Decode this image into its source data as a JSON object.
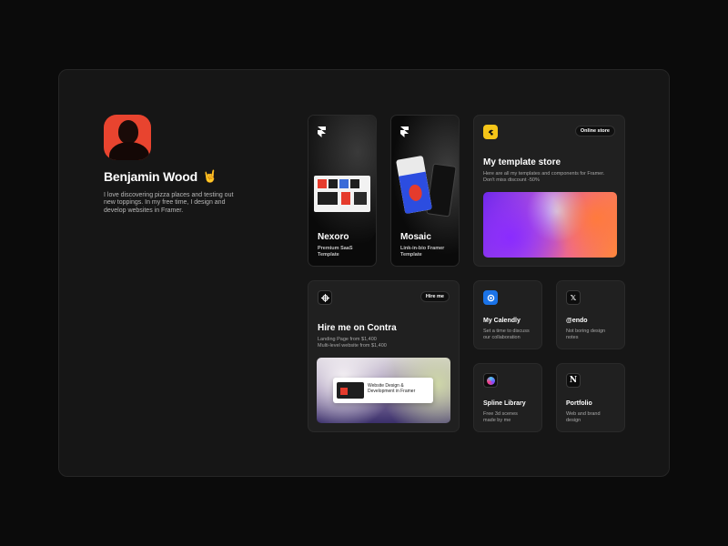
{
  "profile": {
    "name": "Benjamin Wood",
    "emoji": "🤘",
    "bio": "I love discovering pizza places and testing out new toppings. In my free time, I design and develop websites in Framer."
  },
  "cards": {
    "nexoro": {
      "title": "Nexoro",
      "subtitle_line1": "Premium SaaS",
      "subtitle_line2": "Template",
      "icon": "framer-icon"
    },
    "mosaic": {
      "title": "Mosaic",
      "subtitle_line1": "Link-in-bio Framer",
      "subtitle_line2": "Template",
      "icon": "framer-icon"
    },
    "store": {
      "title": "My template store",
      "badge": "Online store",
      "desc_line1": "Here are all my templates and components for Framer.",
      "desc_line2": "Don't miss discount -50%",
      "icon": "lemon-squeezy-icon",
      "icon_color": "#f5c518"
    },
    "contra": {
      "title": "Hire me on Contra",
      "badge": "Hire me",
      "line1": "Landing Page from $1,400",
      "line2": "Multi-level website from $1,400",
      "preview_text": "Website Design & Development in Framer",
      "icon": "contra-icon"
    },
    "calendly": {
      "title": "My Calendly",
      "desc_line1": "Set a time to discuss",
      "desc_line2": "our collaboration",
      "icon": "calendly-icon",
      "icon_color": "#1a73e8"
    },
    "x": {
      "title": "@endo",
      "desc_line1": "Not boring design",
      "desc_line2": "notes",
      "icon": "x-icon"
    },
    "spline": {
      "title": "Spline Library",
      "desc_line1": "Free 3d scenes",
      "desc_line2": "made by me",
      "icon": "spline-icon"
    },
    "notion": {
      "title": "Portfolio",
      "desc_line1": "Web and brand",
      "desc_line2": "design",
      "icon": "notion-icon"
    }
  }
}
